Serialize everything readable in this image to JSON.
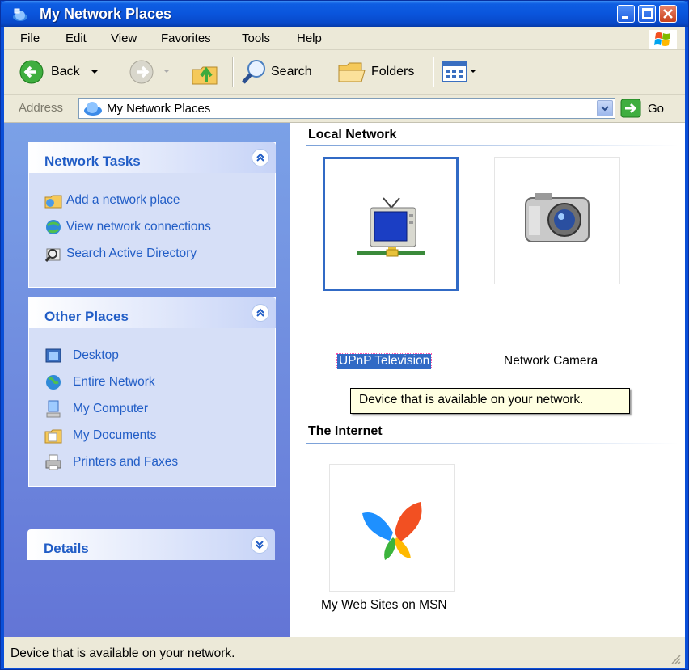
{
  "window": {
    "title": "My Network Places"
  },
  "menu": [
    "File",
    "Edit",
    "View",
    "Favorites",
    "Tools",
    "Help"
  ],
  "toolbar": {
    "back": "Back",
    "search": "Search",
    "folders": "Folders"
  },
  "address": {
    "label": "Address",
    "value": "My Network Places",
    "go": "Go"
  },
  "network_tasks": {
    "title": "Network Tasks",
    "items": [
      "Add a network place",
      "View network connections",
      "Search Active Directory"
    ]
  },
  "other_places": {
    "title": "Other Places",
    "items": [
      "Desktop",
      "Entire Network",
      "My Computer",
      "My Documents",
      "Printers and Faxes"
    ]
  },
  "details": {
    "title": "Details"
  },
  "groups": {
    "local": {
      "title": "Local Network",
      "items": [
        "UPnP Television",
        "Network Camera"
      ]
    },
    "internet": {
      "title": "The Internet",
      "items": [
        "My Web Sites on MSN"
      ]
    }
  },
  "tooltip": "Device that is available on your network.",
  "status": "Device that is available on your network.",
  "colors": {
    "title_bar": "#0a55dc",
    "task_link": "#215dc6",
    "selection": "#316ac5"
  }
}
